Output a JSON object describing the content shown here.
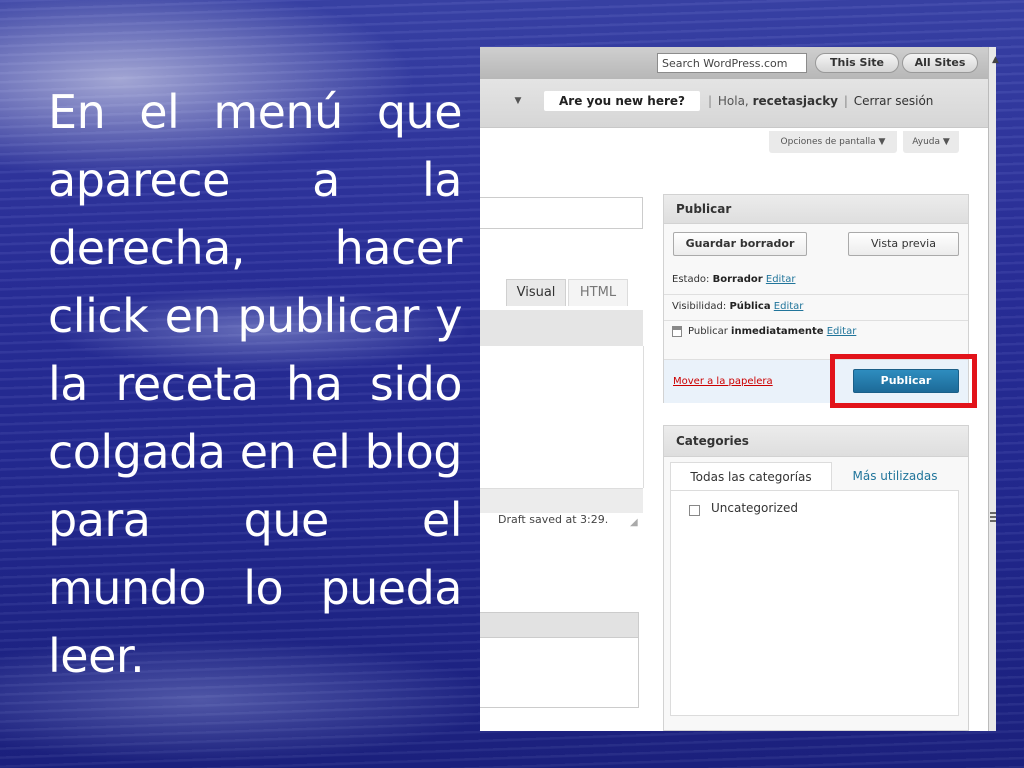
{
  "slide": {
    "text": "En el menú que aparece a la derecha, hacer click en publicar y la receta ha sido colgada en el blog para que el mundo lo pueda leer."
  },
  "wp_admin": {
    "topbar": {
      "search_placeholder": "Search WordPress.com",
      "this_site_label": "This Site",
      "all_sites_label": "All Sites"
    },
    "header": {
      "dropdown_arrow": "▼",
      "new_here_label": "Are you new here?",
      "greeting_prefix": "Hola,",
      "username": "recetasjacky",
      "logout_label": "Cerrar sesión"
    },
    "screen_options_label": "Opciones de pantalla ▼",
    "help_label": "Ayuda ▼",
    "editor": {
      "tab_visual": "Visual",
      "tab_html": "HTML",
      "draft_saved": "Draft saved at 3:29."
    },
    "publish_box": {
      "title": "Publicar",
      "save_draft_label": "Guardar borrador",
      "preview_label": "Vista previa",
      "status_label": "Estado:",
      "status_value": "Borrador",
      "visibility_label": "Visibilidad:",
      "visibility_value": "Pública",
      "schedule_label": "Publicar",
      "schedule_value": "inmediatamente",
      "edit_label": "Editar",
      "trash_label": "Mover a la papelera",
      "publish_label": "Publicar"
    },
    "categories_box": {
      "title": "Categories",
      "tab_all": "Todas las categorías",
      "tab_popular": "Más utilizadas",
      "items": [
        {
          "label": "Uncategorized",
          "checked": false
        }
      ]
    },
    "colors": {
      "highlight_frame": "#e2131a",
      "publish_button": "#21759b",
      "link": "#21759b"
    }
  }
}
